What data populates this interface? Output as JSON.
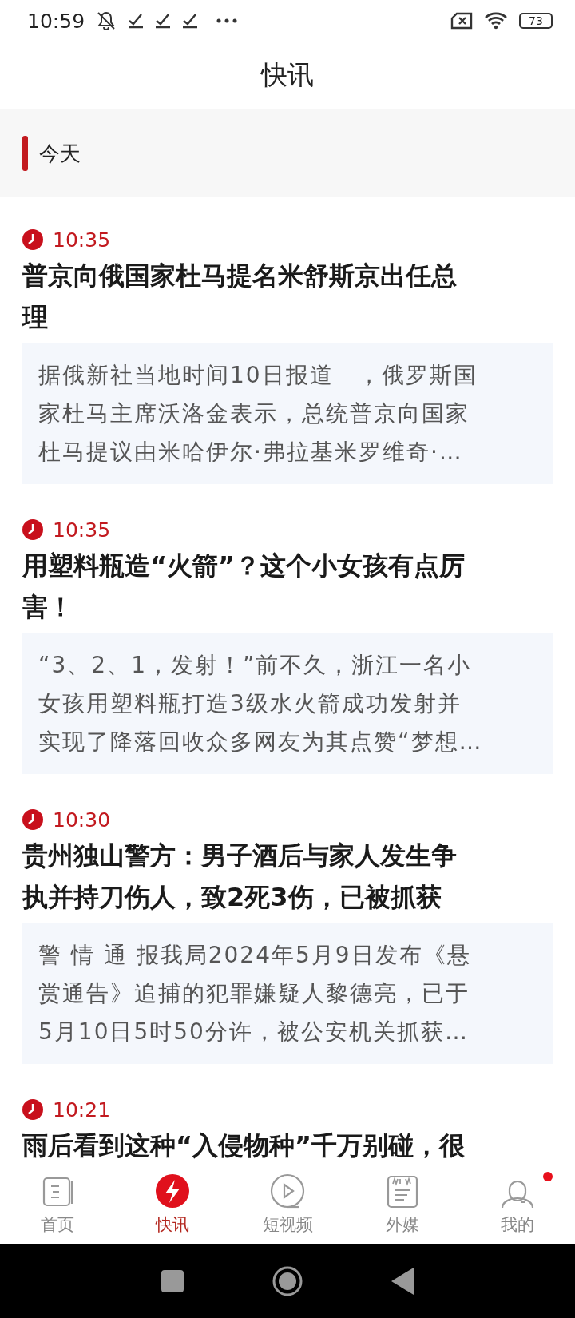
{
  "status_bar": {
    "time": "10:59",
    "battery": "73"
  },
  "window": {
    "title": "快讯"
  },
  "section": {
    "label": "今天"
  },
  "news": [
    {
      "time": "10:35",
      "headline_lines": [
        "普京向俄国家杜马提名米舒斯京出任总",
        "理"
      ],
      "summary_lines": [
        "据俄新社当地时间10日报道　，俄罗斯国",
        "家杜马主席沃洛金表示，总统普京向国家",
        "杜马提议由米哈伊尔·弗拉基米罗维奇·…"
      ]
    },
    {
      "time": "10:35",
      "headline_lines": [
        "用塑料瓶造“火箭”？这个小女孩有点厉",
        "害！"
      ],
      "summary_lines": [
        "“3、2、1，发射！”前不久，浙江一名小",
        "女孩用塑料瓶打造3级水火箭成功发射并",
        "实现了降落回收众多网友为其点赞“梦想…"
      ]
    },
    {
      "time": "10:30",
      "headline_lines": [
        "贵州独山警方：男子酒后与家人发生争",
        "执并持刀伤人，致2死3伤，已被抓获"
      ],
      "summary_lines": [
        "警 情 通 报我局2024年5月9日发布《悬",
        "赏通告》追捕的犯罪嫌疑人黎德亮，已于",
        "5月10日5时50分许，被公安机关抓获…"
      ]
    },
    {
      "time": "10:21",
      "headline_lines": [
        "雨后看到这种“入侵物种”千万别碰，很"
      ]
    }
  ],
  "tabs": [
    {
      "kind": "home",
      "label": "首页",
      "selected": false,
      "dot": false
    },
    {
      "kind": "flash",
      "label": "快讯",
      "selected": true,
      "dot": false
    },
    {
      "kind": "video",
      "label": "短视频",
      "selected": false,
      "dot": false
    },
    {
      "kind": "news",
      "label": "外媒",
      "selected": false,
      "dot": false
    },
    {
      "kind": "profile",
      "label": "我的",
      "selected": false,
      "dot": true
    }
  ]
}
